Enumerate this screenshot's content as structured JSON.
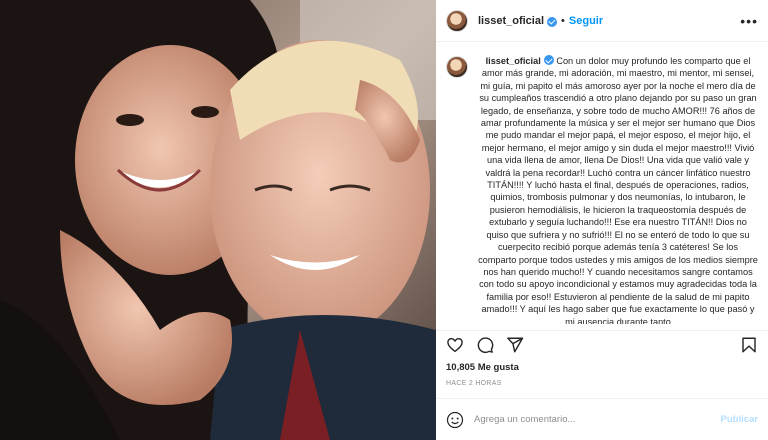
{
  "header": {
    "username": "lisset_oficial",
    "separator": "•",
    "follow_label": "Seguir",
    "more_label": "•••"
  },
  "caption": {
    "username": "lisset_oficial",
    "text": "Con un dolor muy profundo les comparto que el amor más grande, mi adoración, mi maestro, mi mentor, mi sensei, mi guía, mi papito el más amoroso ayer por la noche el mero día de su cumpleaños trascendió a otro plano dejando por su paso un gran legado, de enseñanza, y sobre todo de mucho AMOR!!! 76 años de amar profundamente la música y ser el mejor ser humano que Dios me pudo mandar el mejor papá, el mejor esposo, el mejor hijo, el mejor hermano, el mejor amigo y sin duda el mejor maestro!!! Vivió una vida llena de amor, llena De Dios!! Una vida que valió vale y valdrá la pena recordar!! Luchó contra un cáncer linfático nuestro TITÁN!!!! Y luchó hasta el final, después de operaciones, radios, quimios, trombosis pulmonar y dos neumonías, lo intubaron, le pusieron hemodiálisis, le hicieron la traqueostomía después de extubarlo y seguía luchando!!! Ese era nuestro TITÁN!! Dios no quiso que sufriera y no sufrió!!! El no se enteró de todo lo que su cuerpecito recibió porque además tenía 3 catéteres! Se los comparto porque todos ustedes y mis amigos de los medios siempre nos han querido mucho!! Y cuando necesitamos sangre contamos con todo su apoyo incondicional y estamos muy agradecidas toda la familia por eso!! Estuvieron al pendiente de la salud de mi papito amado!!! Y aquí les hago saber que fue exactamente lo que pasó y mi ausencia durante tanto"
  },
  "actions": {
    "like_icon": "heart-icon",
    "comment_icon": "comment-icon",
    "share_icon": "share-icon",
    "save_icon": "bookmark-icon"
  },
  "likes_text": "10,805 Me gusta",
  "time_ago": "HACE 2 HORAS",
  "comment": {
    "placeholder": "Agrega un comentario...",
    "publish_label": "Publicar",
    "emoji_icon": "emoji-icon"
  },
  "colors": {
    "accent": "#0095f6",
    "verified": "#3897f0",
    "publish_disabled": "#b2dffc",
    "muted": "#8e8e8e"
  }
}
